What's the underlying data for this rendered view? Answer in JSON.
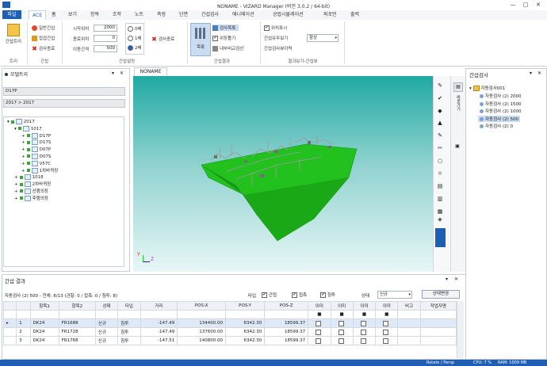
{
  "app": {
    "title": "NONAME - VIZARD Manager (버전 3.0.2 / 64-bit)"
  },
  "window_controls": [
    "—",
    "□",
    "✕"
  ],
  "ribbon": {
    "file_label": "파일",
    "tabs": [
      "ACE",
      "홈",
      "보기",
      "항목",
      "조작",
      "노트",
      "측정",
      "단면",
      "간섭검사",
      "애니메이션",
      "공법시뮬레이션",
      "퍼포먼",
      "출력"
    ],
    "groups": {
      "tree": {
        "button": "간섭트리",
        "label": "트리"
      },
      "interference": {
        "items": [
          "일반간섭",
          "접겹간섭",
          "검사종료"
        ],
        "label": "간섭"
      },
      "settings": {
        "fields": [
          {
            "label": "시작위치",
            "value": "2000"
          },
          {
            "label": "종료위치",
            "value": "0"
          },
          {
            "label": "이동간격",
            "value": "500"
          }
        ],
        "radios": [
          "0배",
          "1배",
          "2배"
        ],
        "label": "간섭설정",
        "delete_button": "검사종료"
      },
      "result": {
        "big_button": "목록",
        "items": [
          "검사목록",
          "위장틀기",
          "내부비교검선"
        ],
        "label": "간섭결과"
      },
      "display": {
        "items": [
          "위치표시",
          "간섭유무보기",
          "간섭검사뷰이력"
        ],
        "select_value": "항상",
        "label": "결과보기-간섭뷰"
      }
    }
  },
  "model_tree": {
    "title": "모델트리",
    "search1": "D17P",
    "search2": "2017 > 2017",
    "items": [
      {
        "label": "2017",
        "level": 0,
        "exp": "▾"
      },
      {
        "label": "1017",
        "level": 1,
        "exp": "▾"
      },
      {
        "label": "D17P",
        "level": 2,
        "exp": "+"
      },
      {
        "label": "D17S",
        "level": 2,
        "exp": "+"
      },
      {
        "label": "D07P",
        "level": 2,
        "exp": "+"
      },
      {
        "label": "D07S",
        "level": 2,
        "exp": "+"
      },
      {
        "label": "V57C",
        "level": 2,
        "exp": "+"
      },
      {
        "label": "1차바퀴장",
        "level": 2,
        "exp": "+"
      },
      {
        "label": "1018",
        "level": 1,
        "exp": "+"
      },
      {
        "label": "2차바퀴장",
        "level": 1,
        "exp": "+"
      },
      {
        "label": "선행의장",
        "level": 1,
        "exp": "+"
      },
      {
        "label": "후행의장",
        "level": 1,
        "exp": "+"
      }
    ]
  },
  "viewport": {
    "tab": "NONAME",
    "axis_y": "Y",
    "axis_z": "Z"
  },
  "right_tools": [
    "✎",
    "✔",
    "◆",
    "▲",
    "✎",
    "✂",
    "○",
    "☼",
    "▤",
    "▥",
    "▦",
    "◈",
    "●",
    "⬡"
  ],
  "side_tabs": [
    "속성",
    "바로가기",
    "제어판"
  ],
  "interference_panel": {
    "title": "간섭검사",
    "root": "자동검사001",
    "items": [
      "자동검사 (2) 2000",
      "자동검사 (2) 1500",
      "자동검사 (2) 1000",
      "자동검사 (2) 500",
      "자동검사 (2) 0"
    ]
  },
  "results": {
    "title": "간섭 결과",
    "summary": "자동검사 (2) 500 - 전체: 8/13 (관찰: 0 / 접촉: 0 / 침투: 8)",
    "filters": [
      {
        "label": "간접",
        "checked": true
      },
      {
        "label": "접촉",
        "checked": true
      },
      {
        "label": "침투",
        "checked": true
      }
    ],
    "filter_prefix": "타입",
    "state_label": "상태",
    "state_value": "신규",
    "apply_button": "상태변경",
    "columns": [
      "항목1",
      "항목2",
      "상태",
      "타입",
      "거리",
      "POS-X",
      "POS-Y",
      "POS-Z",
      "이미",
      "이미",
      "이미",
      "이미",
      "비고",
      "작업자명"
    ],
    "rows": [
      {
        "num": "1",
        "c1": "DK24",
        "c2": "FR1688",
        "state": "신규",
        "type": "침투",
        "dist": "-147.49",
        "x": "134400.00",
        "y": "6342.30",
        "z": "18599.37"
      },
      {
        "num": "2",
        "c1": "DK24",
        "c2": "FR1728",
        "state": "신규",
        "type": "침투",
        "dist": "-147.49",
        "x": "137600.00",
        "y": "6342.30",
        "z": "18599.37"
      },
      {
        "num": "3",
        "c1": "DK24",
        "c2": "FR1768",
        "state": "신규",
        "type": "침투",
        "dist": "-147.51",
        "x": "140800.00",
        "y": "6342.30",
        "z": "18599.37"
      }
    ]
  },
  "status": {
    "mode": "Rotate / Persp",
    "cpu": "CPU: 7 %",
    "ram": "RAM: 1009 MB"
  },
  "colors": {
    "accent": "#1f5fb3",
    "model_green": "#22c11e"
  }
}
